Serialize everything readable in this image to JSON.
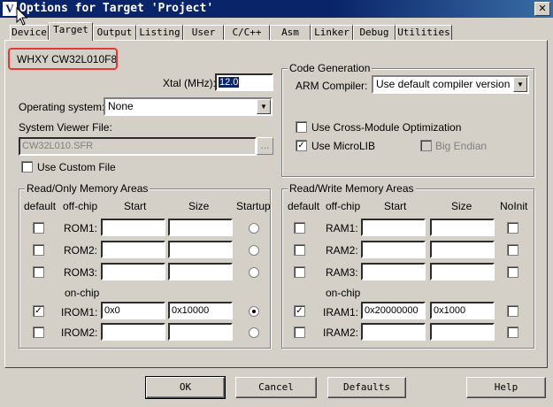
{
  "window": {
    "title": "Options for Target 'Project'",
    "icon_letter": "V",
    "close_glyph": "✕"
  },
  "tabs": [
    {
      "label": "Device",
      "active": false
    },
    {
      "label": "Target",
      "active": true
    },
    {
      "label": "Output",
      "active": false
    },
    {
      "label": "Listing",
      "active": false
    },
    {
      "label": "User",
      "active": false
    },
    {
      "label": "C/C++",
      "active": false
    },
    {
      "label": "Asm",
      "active": false
    },
    {
      "label": "Linker",
      "active": false
    },
    {
      "label": "Debug",
      "active": false
    },
    {
      "label": "Utilities",
      "active": false
    }
  ],
  "device_name": "WHXY CW32L010F8",
  "xtal": {
    "label": "Xtal (MHz):",
    "value": "12.0"
  },
  "os": {
    "label": "Operating system:",
    "value": "None"
  },
  "svf": {
    "label": "System Viewer File:",
    "value": "CW32L010.SFR",
    "browse": "...",
    "custom_label": "Use Custom File"
  },
  "codegen": {
    "title": "Code Generation",
    "compiler_label": "ARM Compiler:",
    "compiler_value": "Use default compiler version",
    "cross_module": "Use Cross-Module Optimization",
    "microlib": "Use MicroLIB",
    "big_endian": "Big Endian"
  },
  "rom": {
    "title": "Read/Only Memory Areas",
    "headers": {
      "default": "default",
      "offchip": "off-chip",
      "start": "Start",
      "size": "Size",
      "startup": "Startup"
    },
    "onchip_label": "on-chip",
    "rows": [
      {
        "name": "ROM1:",
        "start": "",
        "size": ""
      },
      {
        "name": "ROM2:",
        "start": "",
        "size": ""
      },
      {
        "name": "ROM3:",
        "start": "",
        "size": ""
      },
      {
        "name": "IROM1:",
        "start": "0x0",
        "size": "0x10000"
      },
      {
        "name": "IROM2:",
        "start": "",
        "size": ""
      }
    ]
  },
  "ram": {
    "title": "Read/Write Memory Areas",
    "headers": {
      "default": "default",
      "offchip": "off-chip",
      "start": "Start",
      "size": "Size",
      "noinit": "NoInit"
    },
    "onchip_label": "on-chip",
    "rows": [
      {
        "name": "RAM1:",
        "start": "",
        "size": ""
      },
      {
        "name": "RAM2:",
        "start": "",
        "size": ""
      },
      {
        "name": "RAM3:",
        "start": "",
        "size": ""
      },
      {
        "name": "IRAM1:",
        "start": "0x20000000",
        "size": "0x1000"
      },
      {
        "name": "IRAM2:",
        "start": "",
        "size": ""
      }
    ]
  },
  "buttons": {
    "ok": "OK",
    "cancel": "Cancel",
    "defaults": "Defaults",
    "help": "Help"
  },
  "checks": {
    "check_glyph": "✓",
    "dropdown_glyph": "▼"
  },
  "colors": {
    "title_bar": "#0a246a",
    "highlight": "#e53935",
    "face": "#d4d0c8"
  }
}
